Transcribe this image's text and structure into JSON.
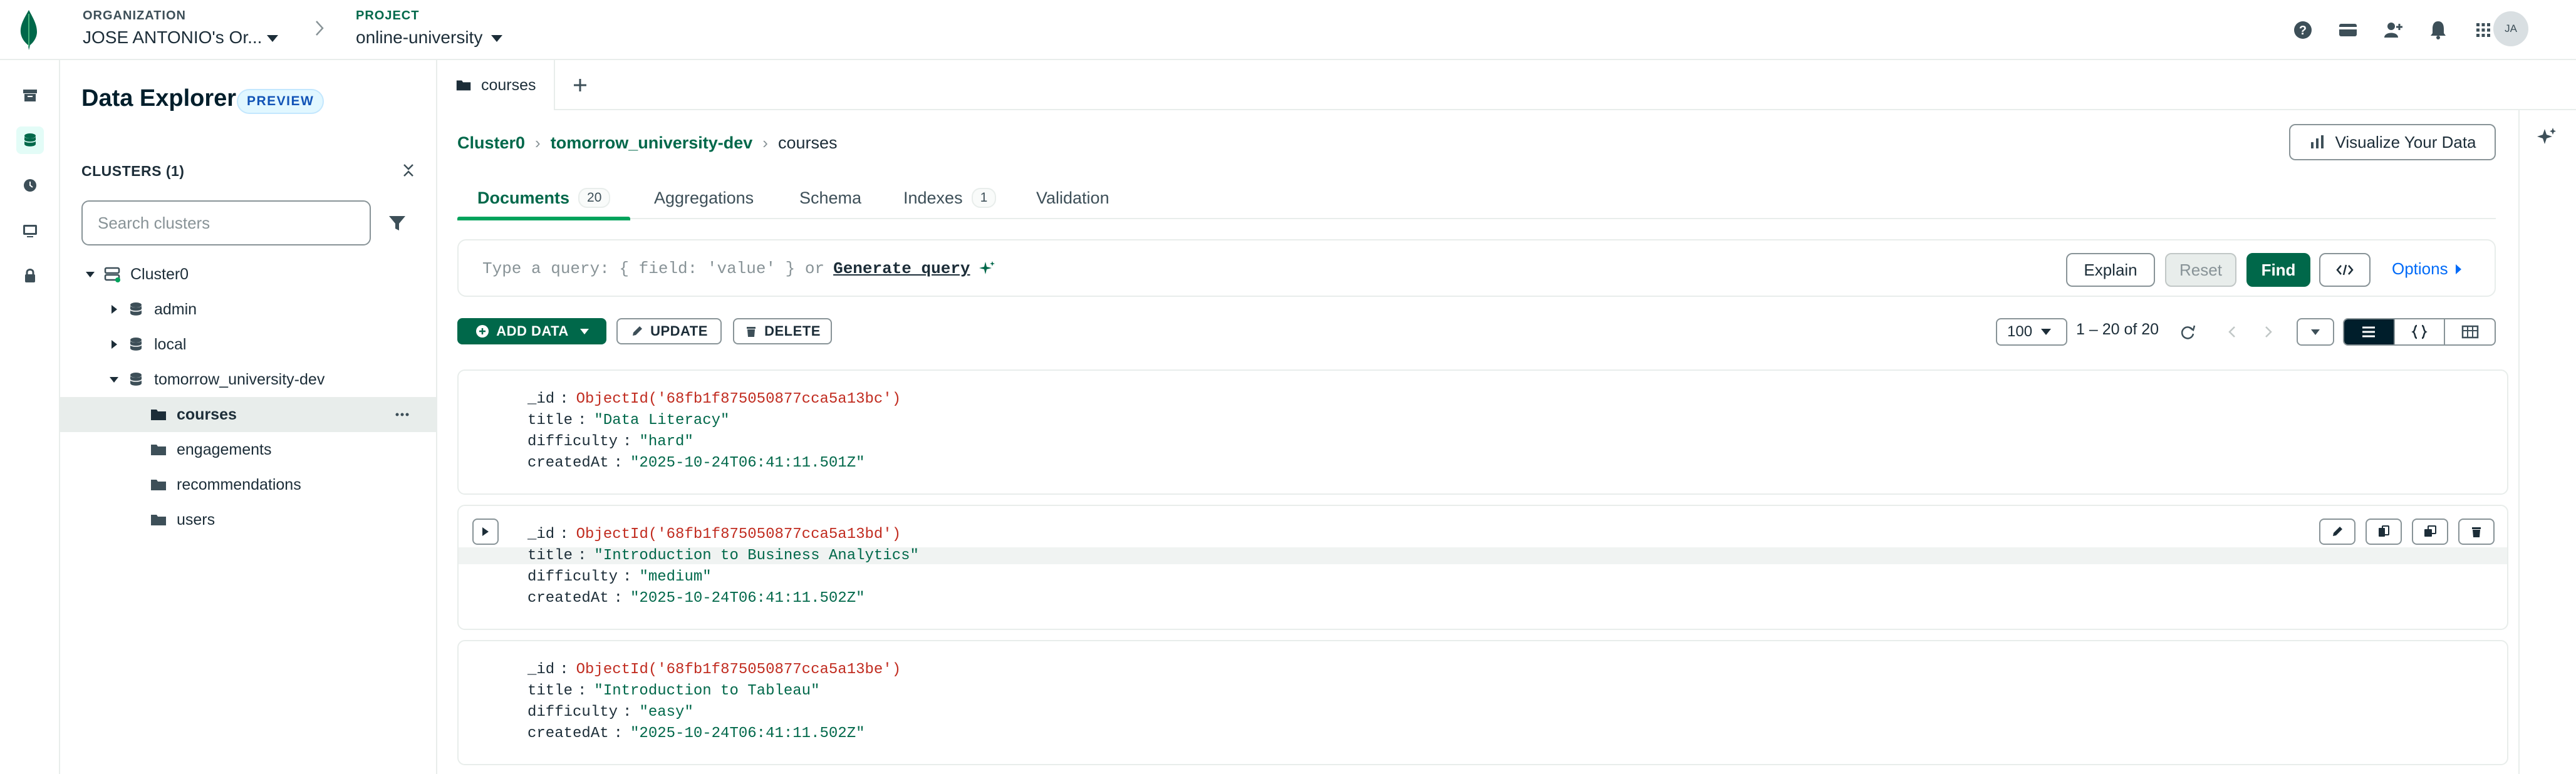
{
  "header": {
    "org_label": "ORGANIZATION",
    "org_value": "JOSE ANTONIO's Or...",
    "project_label": "PROJECT",
    "project_value": "online-university",
    "avatar": "JA",
    "icons": [
      "help-icon",
      "billing-icon",
      "invite-user-icon",
      "notifications-icon",
      "apps-grid-icon"
    ]
  },
  "rail": {
    "items": [
      "archive-icon",
      "database-icon",
      "history-icon",
      "terminal-icon",
      "lock-icon"
    ],
    "active": "database-icon"
  },
  "explorer": {
    "title": "Data Explorer",
    "badge": "PREVIEW",
    "clusters_label": "CLUSTERS (1)",
    "search_placeholder": "Search clusters",
    "tree": {
      "cluster": "Cluster0",
      "databases": [
        "admin",
        "local",
        "tomorrow_university-dev"
      ],
      "collections": [
        "courses",
        "engagements",
        "recommendations",
        "users"
      ],
      "selected": "courses"
    }
  },
  "tabs": {
    "open_tab": "courses"
  },
  "breadcrumb": [
    "Cluster0",
    "tomorrow_university-dev",
    "courses"
  ],
  "visualize_button": "Visualize Your Data",
  "subtabs": [
    {
      "label": "Documents",
      "count": "20"
    },
    {
      "label": "Aggregations"
    },
    {
      "label": "Schema"
    },
    {
      "label": "Indexes",
      "count": "1"
    },
    {
      "label": "Validation"
    }
  ],
  "query": {
    "placeholder": "Type a query: { field: 'value' } or",
    "generate_link": "Generate query",
    "explain": "Explain",
    "reset": "Reset",
    "find": "Find",
    "options": "Options"
  },
  "toolbar": {
    "add_data": "ADD DATA",
    "update": "UPDATE",
    "delete": "DELETE",
    "page_size": "100",
    "pagination": "1 – 20 of 20"
  },
  "documents": [
    {
      "id": "ObjectId('68fb1f875050877cca5a13bc')",
      "title": "\"Data Literacy\"",
      "difficulty": "\"hard\"",
      "createdAt": "\"2025-10-24T06:41:11.501Z\""
    },
    {
      "id": "ObjectId('68fb1f875050877cca5a13bd')",
      "title": "\"Introduction to Business Analytics\"",
      "difficulty": "\"medium\"",
      "createdAt": "\"2025-10-24T06:41:11.502Z\""
    },
    {
      "id": "ObjectId('68fb1f875050877cca5a13be')",
      "title": "\"Introduction to Tableau\"",
      "difficulty": "\"easy\"",
      "createdAt": "\"2025-10-24T06:41:11.502Z\""
    }
  ],
  "field_names": {
    "id": "_id",
    "title": "title",
    "difficulty": "difficulty",
    "createdAt": "createdAt"
  },
  "colors": {
    "brand_green": "#00684a",
    "accent_green": "#00a35c",
    "oid_red": "#c12c20",
    "link_blue": "#016bf8"
  }
}
